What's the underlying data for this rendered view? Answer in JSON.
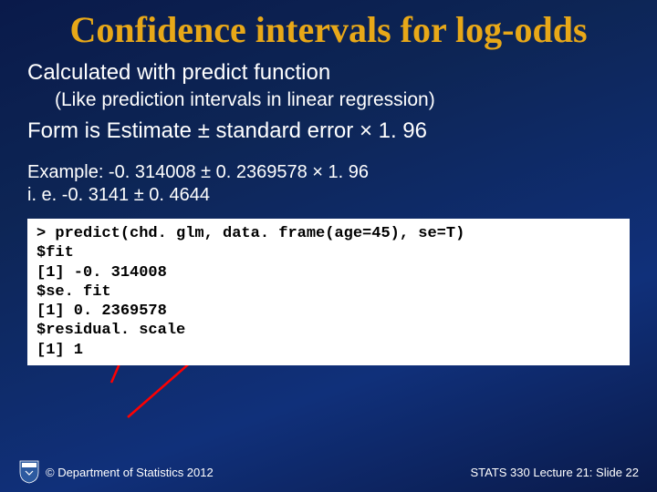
{
  "title": "Confidence intervals for log-odds",
  "line1": "Calculated with predict function",
  "line2": "(Like prediction intervals in  linear regression)",
  "line3": "Form is  Estimate  ±  standard error × 1. 96",
  "example_a": "Example: -0. 314008 ± 0. 2369578 × 1. 96",
  "example_b": "i. e. -0. 3141 ±  0. 4644",
  "code": {
    "l1": "> predict(chd. glm, data. frame(age=45), se=T)",
    "l2": "$fit",
    "l3": "[1] -0. 314008",
    "l4": "$se. fit",
    "l5": "[1] 0. 2369578",
    "l6": "$residual. scale",
    "l7": "[1] 1"
  },
  "footer": {
    "copyright": "© Department of Statistics 2012",
    "slide": "STATS 330 Lecture 21: Slide 22"
  }
}
